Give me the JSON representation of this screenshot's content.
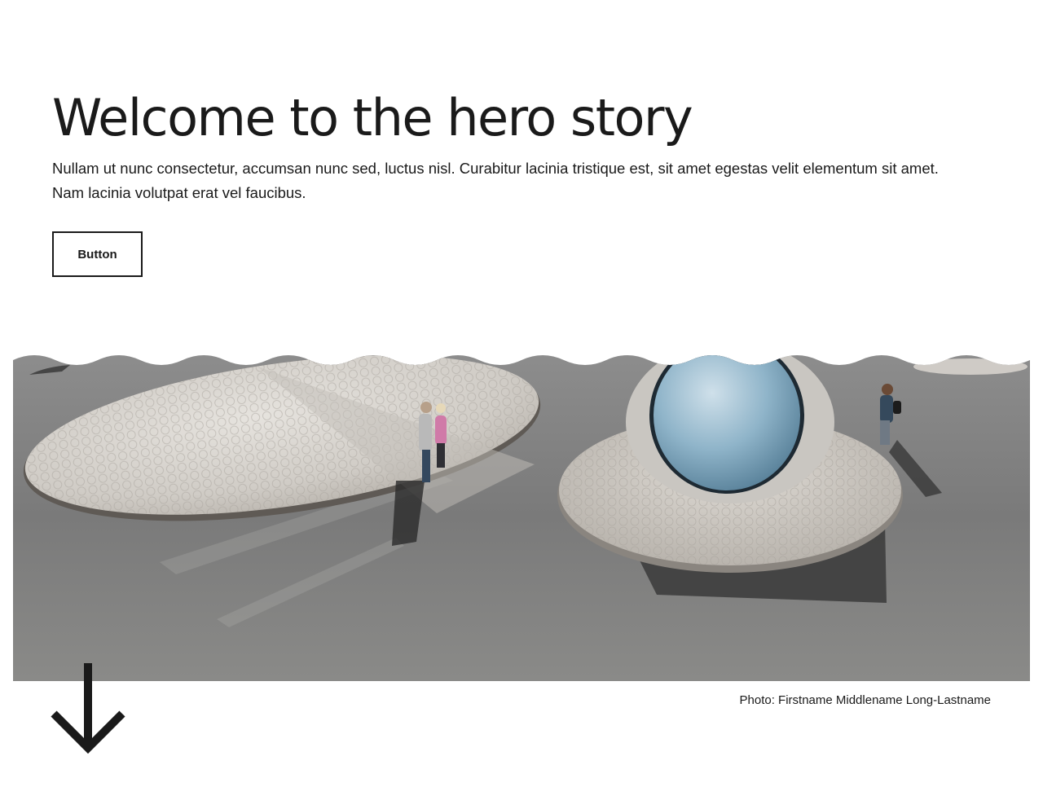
{
  "hero": {
    "title": "Welcome to the hero story",
    "lead": "Nullam ut nunc consectetur, accumsan nunc sed, luctus nisl. Curabitur lacinia tristique est, sit amet egestas velit elementum sit amet. Nam lacinia volutpat erat vel faucibus.",
    "button_label": "Button"
  },
  "image": {
    "caption": "Photo: Firstname Middlename Long-Lastname"
  },
  "icons": {
    "scroll": "arrow-down-icon"
  }
}
